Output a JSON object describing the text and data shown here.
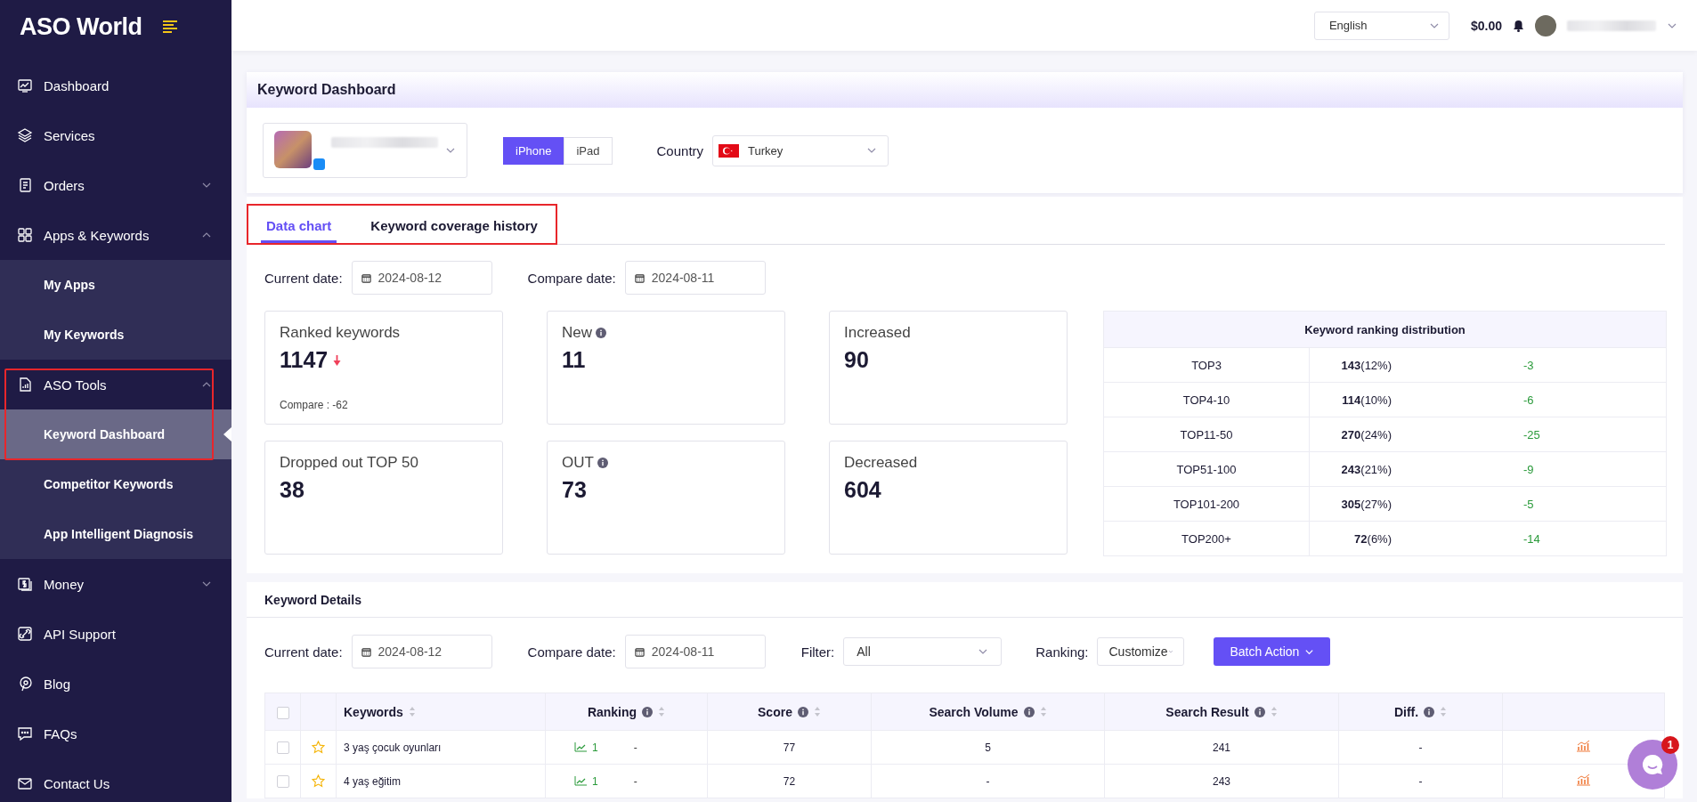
{
  "brand": {
    "name": "ASO World"
  },
  "sidebar": {
    "items": [
      {
        "label": "Dashboard",
        "selected": false
      },
      {
        "label": "Services",
        "selected": false
      },
      {
        "label": "Orders",
        "selected": false,
        "expanded": false
      },
      {
        "label": "Apps & Keywords",
        "selected": false,
        "expanded": true,
        "children": [
          {
            "label": "My Apps",
            "selected": false
          },
          {
            "label": "My Keywords",
            "selected": false
          }
        ]
      },
      {
        "label": "ASO Tools",
        "selected": false,
        "expanded": true,
        "children": [
          {
            "label": "Keyword Dashboard",
            "selected": true
          },
          {
            "label": "Competitor Keywords",
            "selected": false
          },
          {
            "label": "App Intelligent Diagnosis",
            "selected": false
          }
        ]
      },
      {
        "label": "Money",
        "selected": false,
        "expanded": false
      },
      {
        "label": "API Support",
        "selected": false
      },
      {
        "label": "Blog",
        "selected": false
      },
      {
        "label": "FAQs",
        "selected": false
      },
      {
        "label": "Contact Us",
        "selected": false
      }
    ]
  },
  "topbar": {
    "language": "English",
    "balance": "$0.00"
  },
  "page": {
    "title": "Keyword Dashboard",
    "devices": [
      {
        "label": "iPhone",
        "selected": true
      },
      {
        "label": "iPad",
        "selected": false
      }
    ],
    "country_label": "Country",
    "country": "Turkey"
  },
  "tabs": [
    {
      "label": "Data chart",
      "selected": true
    },
    {
      "label": "Keyword coverage history",
      "selected": false
    }
  ],
  "dates": {
    "current_label": "Current date:",
    "current": "2024-08-12",
    "compare_label": "Compare date:",
    "compare": "2024-08-11"
  },
  "stats": [
    {
      "label": "Ranked keywords",
      "value": "1147",
      "info": false,
      "falling": true,
      "compare": "Compare : -62"
    },
    {
      "label": "New",
      "value": "11",
      "info": true,
      "falling": false
    },
    {
      "label": "Increased",
      "value": "90",
      "info": false,
      "falling": false
    },
    {
      "label": "Dropped out TOP 50",
      "value": "38",
      "info": false,
      "falling": false
    },
    {
      "label": "OUT",
      "value": "73",
      "info": true,
      "falling": false
    },
    {
      "label": "Decreased",
      "value": "604",
      "info": false,
      "falling": false
    }
  ],
  "distribution": {
    "title": "Keyword ranking distribution",
    "rows": [
      {
        "range": "TOP3",
        "count": "**143**(12%)",
        "change": "-3"
      },
      {
        "range": "TOP4-10",
        "count": "**114**(10%)",
        "change": "-6"
      },
      {
        "range": "TOP11-50",
        "count": "**270**(24%)",
        "change": "-25"
      },
      {
        "range": "TOP51-100",
        "count": "**243**(21%)",
        "change": "-9"
      },
      {
        "range": "TOP101-200",
        "count": "**305**(27%)",
        "change": "-5"
      },
      {
        "range": "TOP200+",
        "count": "**72**(6%)",
        "change": "-14"
      }
    ]
  },
  "keyword_details": {
    "title": "Keyword Details",
    "current_label": "Current date:",
    "current": "2024-08-12",
    "compare_label": "Compare date:",
    "compare": "2024-08-11",
    "filter_label": "Filter:",
    "filter": "All",
    "ranking_label": "Ranking:",
    "ranking": "Customize",
    "batch_button": "Batch Action"
  },
  "table": {
    "all_checked": false,
    "columns": [
      {
        "label": "Keywords",
        "info": false
      },
      {
        "label": "Ranking",
        "info": true
      },
      {
        "label": "Score",
        "info": true
      },
      {
        "label": "Search Volume",
        "info": true
      },
      {
        "label": "Search Result",
        "info": true
      },
      {
        "label": "Diff.",
        "info": true
      }
    ],
    "rows": [
      {
        "checked": false,
        "starred": false,
        "keyword": "3 yaş çocuk oyunları",
        "ranking": "1",
        "ranking_change": "-",
        "score": "77",
        "search_volume": "5",
        "search_result": "241",
        "diff": "-"
      },
      {
        "checked": false,
        "starred": false,
        "keyword": "4 yaş eğitim",
        "ranking": "1",
        "ranking_change": "-",
        "score": "72",
        "search_volume": "-",
        "search_result": "243",
        "diff": "-"
      }
    ]
  },
  "chat": {
    "badge": "1"
  }
}
